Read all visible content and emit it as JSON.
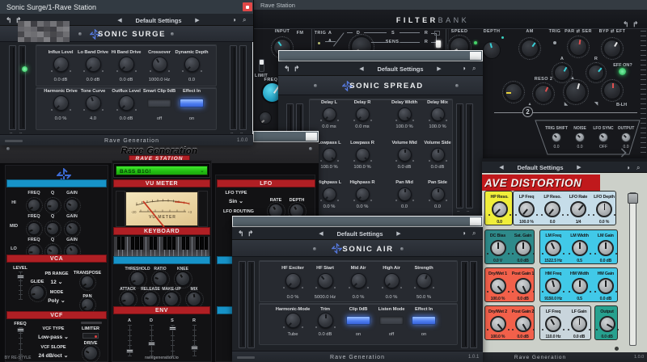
{
  "colors": {
    "desktop": "#141414",
    "titlebar_slate": "#323a42",
    "titlebar_text": "#e7eaec",
    "close_red": "#e04848",
    "toolbar_bg": "#21252b",
    "toolbar_text": "#c9cdd3",
    "sonic_body": "#1f2227",
    "sonic_panel": "#272a30",
    "sonic_header": "#2a2f36",
    "logo_blue": "#5578dd",
    "blue_button": "#4d7dff",
    "green_led": "#3ce06e",
    "synth_bg": "#0c0c0e",
    "band_red": "#b01f24",
    "band_cyan": "#1793c8",
    "display_green": "#2fd41f",
    "vu_face": "#ecd9ad",
    "needle_red": "#cc3524",
    "fb_bg": "#17181c",
    "fb_cyan": "#38cfd8",
    "fb_red": "#e05050",
    "fb_yellow": "#e8d33c",
    "rd_panel": "#ccd0c9",
    "rd_red_header": "#c0191c",
    "rd_yellow": "#f0ee3a",
    "rd_pale_blue": "#c6dde9",
    "rd_teal": "#2e8a8a",
    "rd_cyan": "#41c9e8",
    "rd_red": "#f2604a",
    "rd_gray_blue": "#c9d5dc",
    "rd_teal_dark": "#27a18f",
    "fragment_fill": "#57646d"
  },
  "windows": {
    "sonic_surge": {
      "window_title": "Sonic Surge/1-Rave Station",
      "close_icon": "x",
      "toolbar": {
        "undo_icon": "undo",
        "redo_icon": "redo",
        "prev_icon": "left",
        "preset": "Default Settings",
        "next_icon": "right",
        "contrast_icon": "contrast",
        "zoom_icon": "magnifier"
      },
      "header": {
        "title": "SONIC SURGE"
      },
      "rows": [
        {
          "controls": [
            {
              "type": "knob",
              "label": "Influx Level",
              "value": "0.0 dB",
              "angle": -135
            },
            {
              "type": "knob",
              "label": "Lo Band Drive",
              "value": "0.0 dB",
              "angle": -135
            },
            {
              "type": "knob",
              "label": "Hi Band Drive",
              "value": "0.0 dB",
              "angle": -135
            },
            {
              "type": "knob",
              "label": "Crossover",
              "value": "1000.0 Hz",
              "angle": -30
            },
            {
              "type": "knob",
              "label": "Dynamic Depth",
              "value": "0.0",
              "angle": -135
            }
          ]
        },
        {
          "controls": [
            {
              "type": "knob",
              "label": "Harmonic Drive",
              "value": "0.0 %",
              "angle": -135
            },
            {
              "type": "knob",
              "label": "Tone Curve",
              "value": "4.0",
              "angle": -20
            },
            {
              "type": "knob",
              "label": "Outflux Level",
              "value": "0.0 dB",
              "angle": -135
            },
            {
              "type": "button",
              "label": "Smart Clip 0dB",
              "value": "off",
              "on": false
            },
            {
              "type": "button",
              "label": "Effect In",
              "value": "on",
              "on": true
            }
          ]
        }
      ],
      "footer": {
        "brand": "Rave Generation",
        "version": "1.0.0"
      }
    },
    "filterbank": {
      "window_title": "Rave Station",
      "header": {
        "title_strong": "FILTER",
        "title_light": "BANK",
        "undo_icon": "undo",
        "redo_icon": "redo"
      },
      "labels": {
        "input": "INPUT",
        "fm": "FM",
        "trig": "TRIG",
        "a_top": "A",
        "d": "D",
        "s": "S",
        "r_top": "R",
        "a_mid": "A",
        "sens": "SENS.",
        "r_mid": "R",
        "speed": "SPEED",
        "depth": "DEPTH",
        "am": "AM",
        "trig2": "TRIG",
        "par_ser": "PAR ⇄ SER",
        "byp_eft": "BYP ⇄ EFT",
        "limit": "LIMIT",
        "freq": "FREQ",
        "env_a": "A",
        "env_r": "R",
        "eff_on": "EFF ON?",
        "reso2": "RESO 2",
        "two": "2",
        "b_lh": "B-LH"
      },
      "mini_panel": {
        "items": [
          {
            "label": "TRIG SHIFT",
            "value": "0.0"
          },
          {
            "label": "NOISE",
            "value": "0.0"
          },
          {
            "label": "LFO SYNC",
            "value": "OFF"
          },
          {
            "label": "OUTPUT",
            "value": "0.0"
          }
        ]
      }
    },
    "sonic_spread": {
      "toolbar": {
        "preset": "Default Settings"
      },
      "header": {
        "title": "SONIC SPREAD"
      },
      "rows": [
        {
          "controls": [
            {
              "type": "knob",
              "label": "Delay L",
              "value": "0.0 ms",
              "angle": -135
            },
            {
              "type": "knob",
              "label": "Delay R",
              "value": "0.0 ms",
              "angle": -135
            },
            {
              "type": "knob",
              "label": "Delay Width",
              "value": "100.0 %",
              "angle": 135
            },
            {
              "type": "knob",
              "label": "Delay Mix",
              "value": "100.0 %",
              "angle": 135
            }
          ]
        },
        {
          "controls": [
            {
              "type": "knob",
              "label": "Lowpass L",
              "value": "100.0 %",
              "angle": 135
            },
            {
              "type": "knob",
              "label": "Lowpass R",
              "value": "100.0 %",
              "angle": 135
            },
            {
              "type": "knob",
              "label": "Volume Mid",
              "value": "0.0 dB",
              "angle": 0
            },
            {
              "type": "knob",
              "label": "Volume Side",
              "value": "0.0 dB",
              "angle": 0
            }
          ]
        },
        {
          "controls": [
            {
              "type": "knob",
              "label": "Highpass L",
              "value": "0.0 %",
              "angle": -135
            },
            {
              "type": "knob",
              "label": "Highpass R",
              "value": "0.0 %",
              "angle": -135
            },
            {
              "type": "knob",
              "label": "Pan Mid",
              "value": "0.0",
              "angle": 0
            },
            {
              "type": "knob",
              "label": "Pan Side",
              "value": "0.0",
              "angle": 0
            }
          ]
        }
      ]
    },
    "rave_station": {
      "header": {
        "brand": "Rave Generation",
        "model": "RAVE STATION"
      },
      "preset_display": {
        "value": "BASS B1G!"
      },
      "eq": {
        "rows": [
          {
            "side": "HI",
            "labels": [
              "FREQ",
              "Q",
              "GAIN"
            ]
          },
          {
            "side": "MID",
            "labels": [
              "FREQ",
              "Q",
              "GAIN"
            ]
          },
          {
            "side": "LO",
            "labels": [
              "FREQ",
              "Q",
              "GAIN"
            ]
          }
        ]
      },
      "vca": {
        "title": "VCA",
        "level": "LEVEL",
        "glide": "GLIDE",
        "pb_range_label": "PB RANGE",
        "pb_range_value": "12",
        "mode_label": "MODE",
        "mode_value": "Poly",
        "transpose": "TRANSPOSE",
        "pan": "PAN"
      },
      "vcf": {
        "title": "VCF",
        "freq": "FREQ",
        "type_label": "VCF TYPE",
        "type_value": "Low-pass",
        "slope_label": "VCF SLOPE",
        "slope_value": "24 dB/oct",
        "limiter": "LIMITER",
        "drive": "DRIVE"
      },
      "vu": {
        "title": "VU METER",
        "face_label": "VU METER"
      },
      "keyboard": {
        "title": "KEYBOARD"
      },
      "comp": {
        "row1": [
          "THRESHOLD",
          "RATIO",
          "KNEE"
        ],
        "row2": [
          "ATTACK",
          "RELEASE",
          "MAKE-UP",
          "MIX"
        ]
      },
      "env": {
        "title": "ENV",
        "sliders": [
          "A",
          "D",
          "S",
          "R"
        ]
      },
      "lfo": {
        "title": "LFO",
        "type_label": "LFO TYPE",
        "type_value": "Sin",
        "routing_label": "LFO ROUTING",
        "rate": "RATE",
        "depth": "DEPTH"
      },
      "footer": {
        "left": "BY RE-STYLE",
        "site": "ravegeneration.io"
      }
    },
    "sonic_air": {
      "toolbar": {
        "preset": "Default Settings"
      },
      "header": {
        "title": "SONIC AIR"
      },
      "rows": [
        {
          "controls": [
            {
              "type": "knob",
              "label": "HF Exciter",
              "value": "0.0 %",
              "angle": -135
            },
            {
              "type": "knob",
              "label": "HF Start",
              "value": "5000.0 Hz",
              "angle": -40
            },
            {
              "type": "knob",
              "label": "Mid Air",
              "value": "0.0 %",
              "angle": -135
            },
            {
              "type": "knob",
              "label": "High Air",
              "value": "0.0 %",
              "angle": -135
            },
            {
              "type": "knob",
              "label": "Strength",
              "value": "50.0 %",
              "angle": 20
            }
          ]
        },
        {
          "controls": [
            {
              "type": "knob",
              "label": "Harmonic-Mode",
              "value": "Tube",
              "angle": -135
            },
            {
              "type": "knob",
              "label": "Trim",
              "value": "0.0 dB",
              "angle": 0
            },
            {
              "type": "button",
              "label": "Clip 0dB",
              "value": "on",
              "on": true
            },
            {
              "type": "button",
              "label": "Listen Mode",
              "value": "off",
              "on": false
            },
            {
              "type": "button",
              "label": "Effect In",
              "value": "on",
              "on": true
            }
          ]
        }
      ],
      "footer": {
        "brand": "Rave Generation",
        "version": "1.0.1"
      }
    },
    "rave_distortion": {
      "toolbar": {
        "preset": "Default Settings"
      },
      "header": {
        "title": "AVE DISTORTION"
      },
      "rows": [
        {
          "cells": [
            {
              "color": "rd_yellow",
              "knobs": [
                {
                  "label": "HP Reso.",
                  "value": "0.0",
                  "angle": -135
                }
              ]
            },
            {
              "color": "rd_pale_blue",
              "knobs": [
                {
                  "label": "LP Freq",
                  "value": "100.0 %",
                  "angle": -140
                },
                {
                  "label": "LP Reso.",
                  "value": "0.0",
                  "angle": -140
                },
                {
                  "label": "LFO Rate",
                  "value": "1/4",
                  "angle": 40
                },
                {
                  "label": "LFO Depth",
                  "value": "0.0 %",
                  "angle": 0
                }
              ]
            }
          ]
        },
        {
          "cells": [
            {
              "color": "rd_teal",
              "knobs": [
                {
                  "label": "DC Bias",
                  "value": "0.0 V",
                  "angle": 0
                },
                {
                  "label": "Sat. Gain",
                  "value": "0.0 dB",
                  "angle": 0
                }
              ]
            },
            {
              "color": "rd_cyan",
              "knobs": [
                {
                  "label": "LM Freq",
                  "value": "1522.5 Hz",
                  "angle": -25
                },
                {
                  "label": "LM Width",
                  "value": "0.5",
                  "angle": 0
                },
                {
                  "label": "LM Gain",
                  "value": "0.0 dB",
                  "angle": 0
                }
              ]
            }
          ]
        },
        {
          "cells": [
            {
              "color": "rd_red",
              "knobs": [
                {
                  "label": "Dry/Wet 1",
                  "value": "100.0 %",
                  "angle": 140
                },
                {
                  "label": "Post Gain 1",
                  "value": "0.0 dB",
                  "angle": 155
                }
              ]
            },
            {
              "color": "rd_cyan",
              "knobs": [
                {
                  "label": "HM Freq",
                  "value": "9150.0 Hz",
                  "angle": -15
                },
                {
                  "label": "HM Width",
                  "value": "0.5",
                  "angle": 0
                },
                {
                  "label": "HM Gain",
                  "value": "0.0 dB",
                  "angle": 0
                }
              ]
            }
          ]
        },
        {
          "cells": [
            {
              "color": "rd_red",
              "knobs": [
                {
                  "label": "Dry/Wet 2",
                  "value": "100.0 %",
                  "angle": 140
                },
                {
                  "label": "Post Gain 2",
                  "value": "0.0 dB",
                  "angle": 150
                }
              ]
            },
            {
              "color": "rd_gray_blue",
              "knobs": [
                {
                  "label": "LF Freq",
                  "value": "110.0 Hz",
                  "angle": -30
                },
                {
                  "label": "LF Gain",
                  "value": "0.0 dB",
                  "angle": 0
                }
              ]
            },
            {
              "color": "rd_teal_dark",
              "knobs": [
                {
                  "label": "Output",
                  "value": "0.0 dB",
                  "angle": 120
                }
              ]
            }
          ]
        }
      ],
      "footer": {
        "brand": "Rave Generation",
        "version": "1.0.0"
      }
    }
  }
}
